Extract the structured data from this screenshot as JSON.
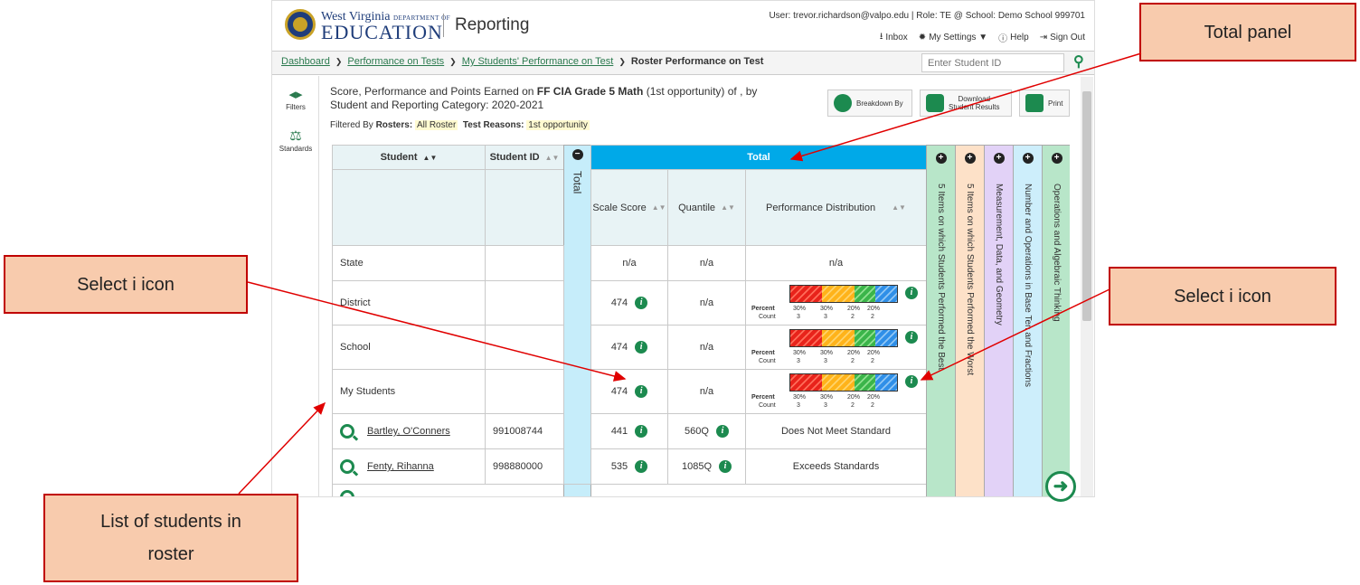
{
  "header": {
    "logo_line1": "West Virginia",
    "logo_line1_small": "DEPARTMENT OF",
    "logo_line2": "EDUCATION",
    "app_title": "Reporting",
    "user_info": "User: trevor.richardson@valpo.edu  |  Role: TE @ School: Demo School 999701",
    "links": {
      "inbox": "Inbox",
      "settings": "My Settings ▼",
      "help": "Help",
      "signout": "Sign Out"
    }
  },
  "breadcrumb": {
    "items": [
      "Dashboard",
      "Performance on Tests",
      "My Students' Performance on Test"
    ],
    "current": "Roster Performance on Test"
  },
  "student_search": {
    "placeholder": "Enter Student ID"
  },
  "leftnav": {
    "filters": "Filters",
    "standards": "Standards"
  },
  "report": {
    "heading_pre": "Score, Performance and Points Earned on ",
    "heading_test": "FF CIA Grade 5 Math",
    "heading_post": " (1st opportunity) of , by",
    "heading_line2": "Student and Reporting Category: 2020-2021",
    "filtered_by": "Filtered By",
    "rosters_label": "Rosters:",
    "rosters_value": "All Roster",
    "reasons_label": "Test Reasons:",
    "reasons_value": "1st opportunity"
  },
  "toolbar": {
    "breakdown": "Breakdown By",
    "download_l1": "Download",
    "download_l2": "Student Results",
    "print": "Print"
  },
  "table": {
    "col_student": "Student",
    "col_student_id": "Student ID",
    "col_total_vertical": "Total",
    "col_total": "Total",
    "col_scale": "Scale Score",
    "col_quantile": "Quantile",
    "col_perf": "Performance Distribution",
    "side_cols": [
      "5 Items on which Students Performed the Best",
      "5 Items on which Students Performed the Worst",
      "Measurement, Data, and Geometry",
      "Number and Operations in Base Ten and Fractions",
      "Operations and Algebraic Thinking"
    ],
    "side_colors": [
      "#b8e6c9",
      "#fde1c8",
      "#e2d2f7",
      "#cdeefb",
      "#b8e6c9"
    ],
    "rows": [
      {
        "name": "State",
        "id": "",
        "scale": "n/a",
        "quantile": "n/a",
        "perf": "n/a"
      },
      {
        "name": "District",
        "id": "",
        "scale": "474",
        "quantile": "n/a"
      },
      {
        "name": "School",
        "id": "",
        "scale": "474",
        "quantile": "n/a"
      },
      {
        "name": "My Students",
        "id": "",
        "scale": "474",
        "quantile": "n/a"
      },
      {
        "name": "Bartley, O'Conners",
        "id": "991008744",
        "scale": "441",
        "quantile": "560Q",
        "perf": "Does Not Meet Standard"
      },
      {
        "name": "Fenty, Rihanna",
        "id": "998880000",
        "scale": "535",
        "quantile": "1085Q",
        "perf": "Exceeds Standards"
      }
    ],
    "dist": {
      "percent_label": "Percent",
      "count_label": "Count",
      "percents": [
        "30%",
        "30%",
        "20%",
        "20%"
      ],
      "counts": [
        "3",
        "3",
        "2",
        "2"
      ],
      "fractions": [
        0.3,
        0.3,
        0.2,
        0.2
      ]
    }
  },
  "annotations": {
    "total_panel": "Total panel",
    "select_i_left": "Select i icon",
    "select_i_right": "Select i icon",
    "roster_l1": "List of students in",
    "roster_l2": "roster"
  }
}
